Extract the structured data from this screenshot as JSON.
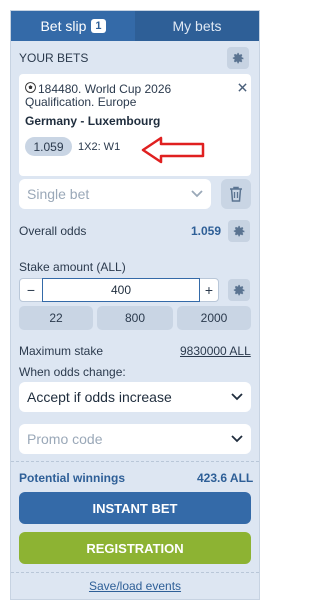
{
  "tabs": {
    "bet_slip": "Bet slip",
    "bet_slip_count": "1",
    "my_bets": "My bets"
  },
  "your_bets_label": "YOUR BETS",
  "bet": {
    "event_id_league": "184480. World Cup 2026",
    "league_sub": "Qualification. Europe",
    "match": "Germany - Luxembourg",
    "odds": "1.059",
    "market": "1X2: W1"
  },
  "bet_type": {
    "value": "Single bet"
  },
  "overall_odds": {
    "label": "Overall odds",
    "value": "1.059"
  },
  "stake": {
    "label": "Stake amount (ALL)",
    "minus": "−",
    "value": "400",
    "plus": "+",
    "presets": [
      "22",
      "800",
      "2000"
    ]
  },
  "max_stake": {
    "label": "Maximum stake",
    "value": "9830000 ALL"
  },
  "odds_change": {
    "label": "When odds change:",
    "value": "Accept if odds increase"
  },
  "promo": {
    "placeholder": "Promo code"
  },
  "winnings": {
    "label": "Potential winnings",
    "value": "423.6 ALL"
  },
  "buttons": {
    "instant_bet": "INSTANT BET",
    "registration": "REGISTRATION"
  },
  "save_load": "Save/load events",
  "colors": {
    "accent": "#346aa8",
    "green": "#8db333",
    "annotation_red": "#e02020",
    "panel_bg": "#dde6f2"
  }
}
